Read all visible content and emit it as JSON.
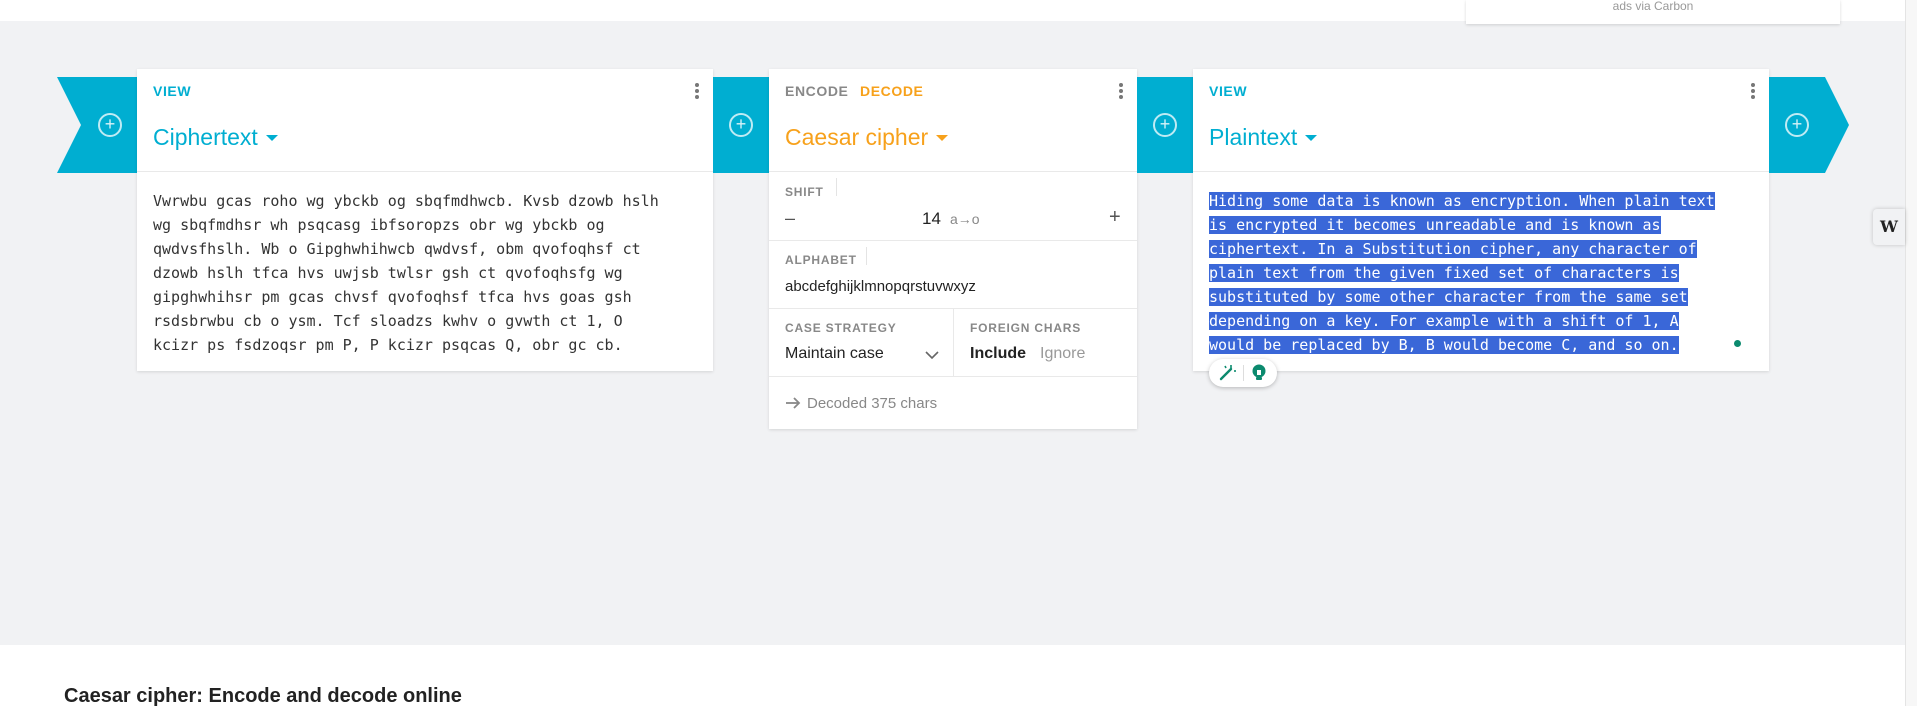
{
  "ad": {
    "caption": "ads via Carbon"
  },
  "colors": {
    "view": "#00aed1",
    "operation": "#f7a11b",
    "selection": "#3a67d8"
  },
  "input_card": {
    "kind": "VIEW",
    "title": "Ciphertext",
    "lines": [
      "Vwrwbu gcas roho wg ybckb og sbqfmdhwcb. Kvsb dzowb hslh",
      "wg sbqfmdhsr wh psqcasg ibfsoropzs obr wg ybckb og",
      "qwdvsfhslh. Wb o Gipghwhihwcb qwdvsf, obm qvofoqhsf ct",
      "dzowb hslh tfca hvs uwjsb twlsr gsh ct qvofoqhsfg wg",
      "gipghwhihsr pm gcas chvsf qvofoqhsf tfca hvs goas gsh",
      "rsdsbrwbu cb o ysm. Tcf sloadzs kwhv o gvwth ct 1, O",
      "kcizr ps fsdzoqsr pm P, P kcizr psqcas Q, obr gc cb."
    ]
  },
  "operation_card": {
    "tab_encode": "ENCODE",
    "tab_decode": "DECODE",
    "title": "Caesar cipher",
    "shift_label": "SHIFT",
    "shift_value": "14",
    "shift_hint": "a→o",
    "minus": "–",
    "plus": "+",
    "alphabet_label": "ALPHABET",
    "alphabet_value": "abcdefghijklmnopqrstuvwxyz",
    "case_label": "CASE STRATEGY",
    "case_value": "Maintain case",
    "foreign_label": "FOREIGN CHARS",
    "foreign_include": "Include",
    "foreign_ignore": "Ignore",
    "status": "Decoded 375 chars"
  },
  "output_card": {
    "kind": "VIEW",
    "title": "Plaintext",
    "lines": [
      "Hiding some data is known as encryption. When plain text",
      "is encrypted it becomes unreadable and is known as",
      "ciphertext. In a Substitution cipher, any character of",
      "plain text from the given fixed set of characters is",
      "substituted by some other character from the same set",
      "depending on a key. For example with a shift of 1, A",
      "would be replaced by B, B would become C, and so on."
    ]
  },
  "footer": {
    "title": "Caesar cipher: Encode and decode online"
  },
  "side_widget": {
    "letter": "W"
  },
  "icons": [
    "add-circle-icon",
    "more-vert-icon",
    "caret-down-icon",
    "arrow-right-icon",
    "chevron-down-icon",
    "magic-wand-icon",
    "lightbulb-icon"
  ]
}
